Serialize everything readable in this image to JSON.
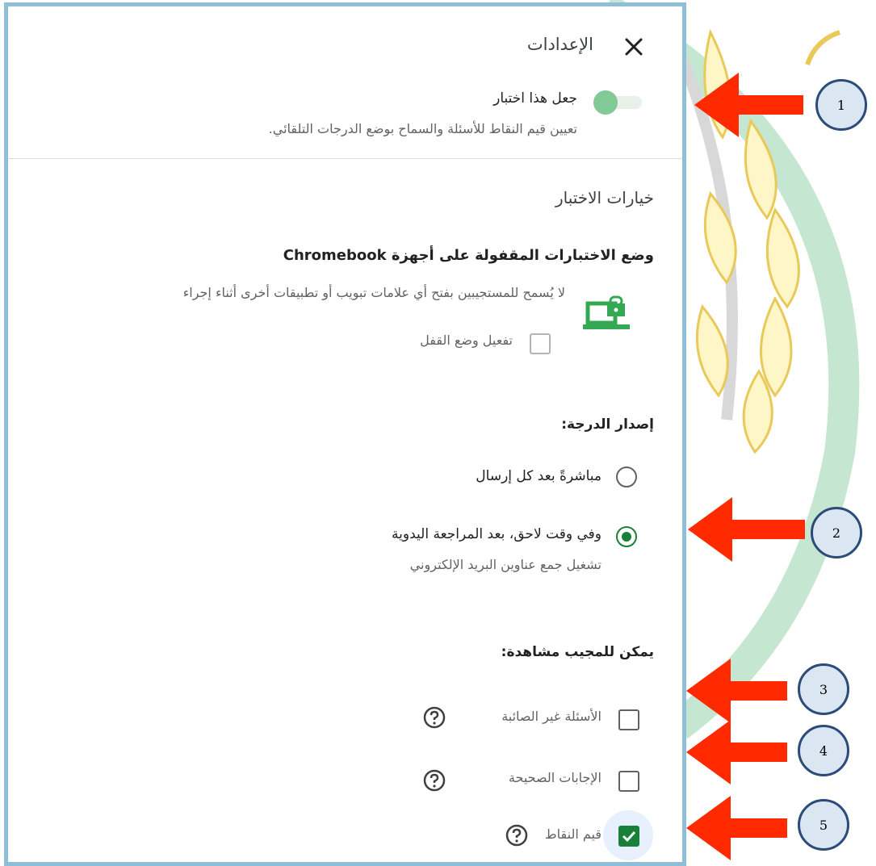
{
  "settings": {
    "title": "الإعدادات",
    "close_icon": "close-icon",
    "quiz_toggle": {
      "label": "جعل هذا اختبار",
      "description": "تعيين قيم النقاط للأسئلة والسماح بوضع الدرجات التلقائي.",
      "on": true
    },
    "quiz_options_title": "خيارات الاختبار",
    "locked_mode": {
      "title": "وضع الاختبارات المقفولة على أجهزة Chromebook",
      "description": "لا يُسمح للمستجيبين بفتح أي علامات تبويب أو تطبيقات أخرى أثناء إجراء",
      "checkbox_label": "تفعيل وضع القفل",
      "checked": false,
      "icon": "chromebook-lock-icon"
    },
    "release_grade": {
      "title": "إصدار الدرجة:",
      "options": [
        {
          "label": "مباشرةً بعد كل إرسال",
          "selected": false
        },
        {
          "label": "وفي وقت لاحق، بعد المراجعة اليدوية",
          "description": "تشغيل جمع عناوين البريد الإلكتروني",
          "selected": true
        }
      ]
    },
    "respondent_can_see": {
      "title": "يمكن للمجيب مشاهدة:",
      "items": [
        {
          "label": "الأسئلة غير الصائبة",
          "checked": false
        },
        {
          "label": "الإجابات الصحيحة",
          "checked": false
        },
        {
          "label": "قيم النقاط",
          "checked": true
        }
      ]
    }
  },
  "annotations": [
    "1",
    "2",
    "3",
    "4",
    "5"
  ],
  "colors": {
    "accent_green": "#188038",
    "toggle_thumb": "#81c995",
    "panel_border": "#8fbfd8",
    "arrow_red": "#ff2a00",
    "annotation_border": "#2b4b78"
  }
}
